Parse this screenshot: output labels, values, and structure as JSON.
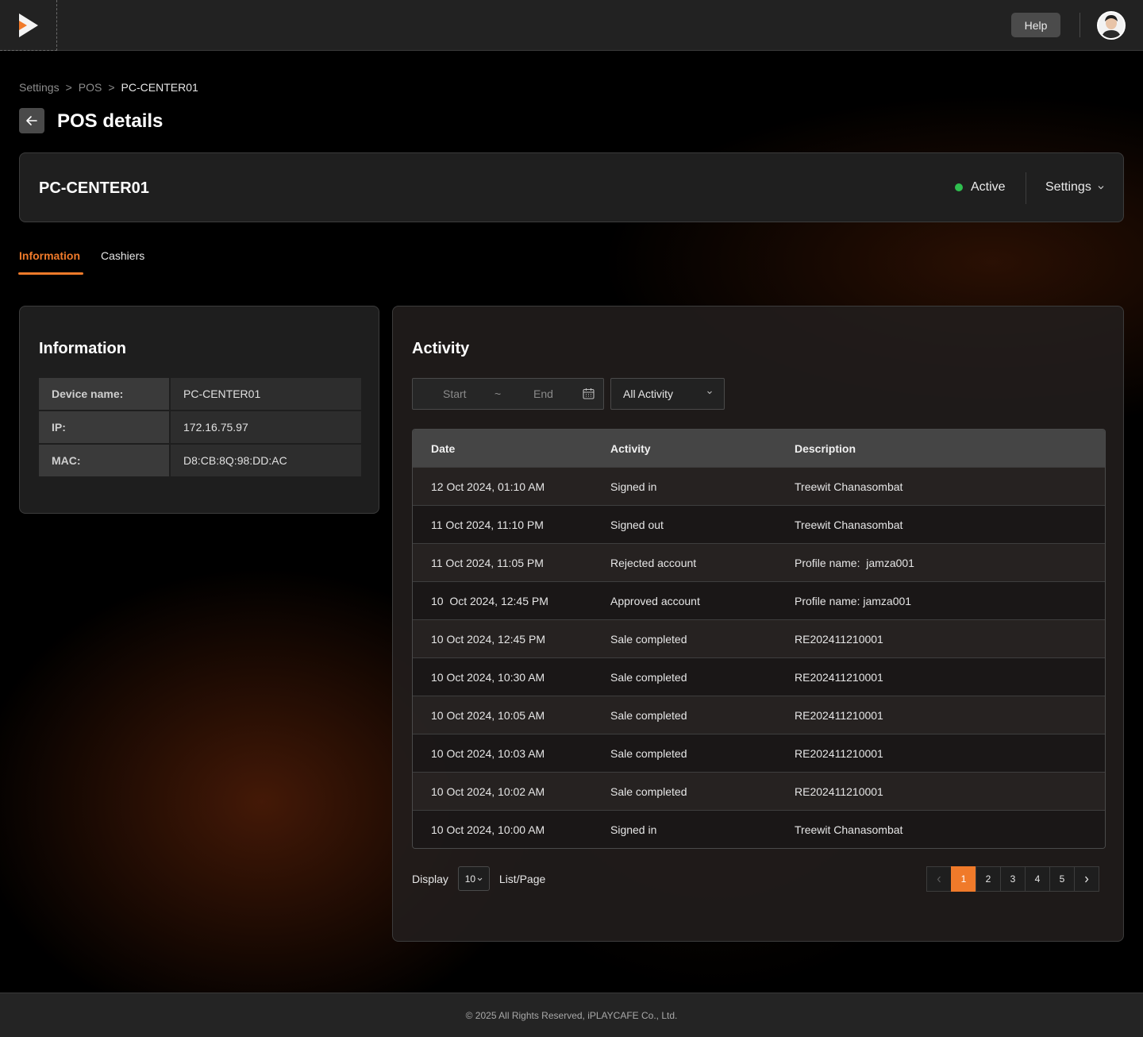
{
  "topbar": {
    "help_label": "Help"
  },
  "breadcrumb": {
    "items": [
      "Settings",
      "POS",
      "PC-CENTER01"
    ],
    "separator": ">"
  },
  "page": {
    "title": "POS details"
  },
  "device": {
    "name": "PC-CENTER01",
    "status": "Active",
    "status_color": "#2fbf4f",
    "settings_label": "Settings"
  },
  "tabs": [
    {
      "label": "Information",
      "active": true
    },
    {
      "label": "Cashiers",
      "active": false
    }
  ],
  "information": {
    "title": "Information",
    "rows": [
      {
        "key": "Device name:",
        "value": "PC-CENTER01"
      },
      {
        "key": "IP:",
        "value": "172.16.75.97"
      },
      {
        "key": "MAC:",
        "value": "D8:CB:8Q:98:DD:AC"
      }
    ]
  },
  "activity": {
    "title": "Activity",
    "filter": {
      "start_placeholder": "Start",
      "range_separator": "~",
      "end_placeholder": "End",
      "activity_select": "All Activity"
    },
    "columns": [
      "Date",
      "Activity",
      "Description"
    ],
    "rows": [
      {
        "date": "12 Oct 2024, 01:10 AM",
        "activity": "Signed in",
        "description": "Treewit Chanasombat"
      },
      {
        "date": "11 Oct 2024, 11:10 PM",
        "activity": "Signed out",
        "description": "Treewit Chanasombat"
      },
      {
        "date": "11 Oct 2024, 11:05 PM",
        "activity": "Rejected account",
        "description": "Profile name:  jamza001"
      },
      {
        "date": "10  Oct 2024, 12:45 PM",
        "activity": "Approved account",
        "description": "Profile name: jamza001"
      },
      {
        "date": "10 Oct 2024, 12:45 PM",
        "activity": "Sale completed",
        "description": "RE202411210001"
      },
      {
        "date": "10 Oct 2024, 10:30 AM",
        "activity": "Sale completed",
        "description": "RE202411210001"
      },
      {
        "date": "10 Oct 2024, 10:05 AM",
        "activity": "Sale completed",
        "description": "RE202411210001"
      },
      {
        "date": "10 Oct 2024, 10:03 AM",
        "activity": "Sale completed",
        "description": "RE202411210001"
      },
      {
        "date": "10 Oct 2024, 10:02 AM",
        "activity": "Sale completed",
        "description": "RE202411210001"
      },
      {
        "date": "10 Oct 2024, 10:00 AM",
        "activity": "Signed in",
        "description": "Treewit Chanasombat"
      }
    ],
    "pagination": {
      "display_label": "Display",
      "per_page": "10",
      "per_page_suffix": "List/Page",
      "pages": [
        "1",
        "2",
        "3",
        "4",
        "5"
      ],
      "current_page": "1"
    }
  },
  "footer": {
    "text": "© 2025 All Rights Reserved, iPLAYCAFE Co., Ltd."
  },
  "colors": {
    "accent": "#f07a2a",
    "status_active": "#2fbf4f"
  }
}
